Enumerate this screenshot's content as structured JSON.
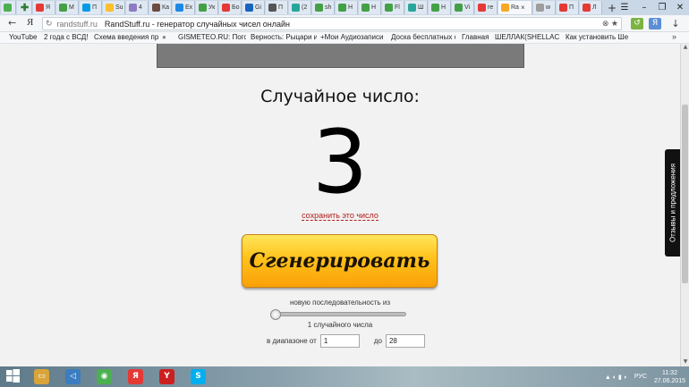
{
  "browser": {
    "tabs": [
      {
        "label": "Я",
        "color": "#e53935"
      },
      {
        "label": "M",
        "color": "#43a047"
      },
      {
        "label": "П",
        "color": "#039be5"
      },
      {
        "label": "Su",
        "color": "#fbc02d"
      },
      {
        "label": "4",
        "color": "#8e7cc3"
      },
      {
        "label": "Ка",
        "color": "#6d4c41"
      },
      {
        "label": "Ех",
        "color": "#1e88e5"
      },
      {
        "label": "Ук",
        "color": "#43a047"
      },
      {
        "label": "Бо",
        "color": "#e53935"
      },
      {
        "label": "Gi",
        "color": "#1565c0"
      },
      {
        "label": "П",
        "color": "#555555"
      },
      {
        "label": "(2",
        "color": "#26a69a"
      },
      {
        "label": "sh",
        "color": "#43a047"
      },
      {
        "label": "Н",
        "color": "#43a047"
      },
      {
        "label": "Н",
        "color": "#43a047"
      },
      {
        "label": "Fl",
        "color": "#43a047"
      },
      {
        "label": "Ш",
        "color": "#26a69a"
      },
      {
        "label": "Н",
        "color": "#43a047"
      },
      {
        "label": "Vi",
        "color": "#43a047"
      },
      {
        "label": "re",
        "color": "#e53935"
      },
      {
        "label": "Ra",
        "color": "#f9a825",
        "active": true
      },
      {
        "label": "w",
        "color": "#9e9e9e"
      },
      {
        "label": "П",
        "color": "#e53935"
      },
      {
        "label": "Л",
        "color": "#e53935"
      }
    ],
    "new_tab": "+",
    "window_controls": {
      "menu": "☰",
      "minimize": "–",
      "maximize": "❐",
      "close": "✕"
    },
    "nav": {
      "back": "←",
      "yandex": "Я"
    },
    "url": {
      "domain": "randstuff.ru",
      "page_title": "RandStuff.ru - генератор случайных чисел онлайн"
    },
    "bookmarks": [
      "YouTube",
      "2 года с ВСД!",
      "Схема введения пр",
      "GISMETEO.RU: Пого",
      "Верность: Рыцари и",
      "+Мои Аудиозаписи",
      "Доска бесплатных о",
      "Главная",
      "ШЕЛЛАК(SHELLAC)",
      "Как установить Ше"
    ],
    "bookmarks_more": "»"
  },
  "page": {
    "label": "Случайное число:",
    "number": "3",
    "save_link": "сохранить это число",
    "generate_button": "Сгенерировать",
    "sequence_label": "новую последовательность из",
    "slider": {
      "value": 1,
      "min": 1,
      "max": 100
    },
    "count_label": "1 случайного числа",
    "range": {
      "from_label": "в диапазоне от",
      "from_value": "1",
      "to_label": "до",
      "to_value": "28"
    },
    "feedback_tab": "Отзывы и предложения"
  },
  "taskbar": {
    "icons": [
      {
        "name": "explorer",
        "color": "#d9a43a"
      },
      {
        "name": "volume",
        "color": "#3b7dbf"
      },
      {
        "name": "chrome",
        "color": "#4caf50"
      },
      {
        "name": "yandex",
        "color": "#e53935"
      },
      {
        "name": "yandex-browser",
        "color": "#cc1f1f"
      },
      {
        "name": "skype",
        "color": "#00aff0"
      }
    ],
    "lang": "РУС",
    "time": "11:32",
    "date": "27.06.2015"
  }
}
